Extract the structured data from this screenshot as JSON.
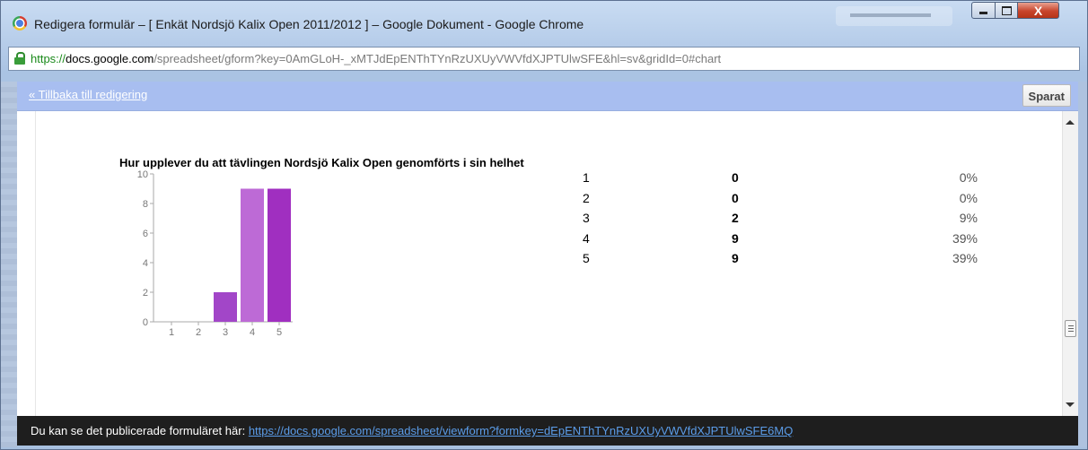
{
  "window": {
    "title": "Redigera formulär – [ Enkät Nordsjö Kalix Open 2011/2012 ] – Google Dokument - Google Chrome",
    "controls": {
      "minimize": "",
      "maximize": "",
      "close": "X"
    }
  },
  "address": {
    "scheme": "https://",
    "host": "docs.google.com",
    "path": "/spreadsheet/gform?key=0AmGLoH-_xMTJdEpENThTYnRzUXUyVWVfdXJPTUlwSFE&hl=sv&gridId=0#chart"
  },
  "dialog": {
    "back_link": "« Tillbaka till redigering",
    "saved_button": "Sparat"
  },
  "question": {
    "title": "Hur upplever du att tävlingen Nordsjö Kalix Open genomförts i sin helhet",
    "rows": [
      {
        "label": "1",
        "count": "0",
        "percent": "0%"
      },
      {
        "label": "2",
        "count": "0",
        "percent": "0%"
      },
      {
        "label": "3",
        "count": "2",
        "percent": "9%"
      },
      {
        "label": "4",
        "count": "9",
        "percent": "39%"
      },
      {
        "label": "5",
        "count": "9",
        "percent": "39%"
      }
    ]
  },
  "chart_data": {
    "type": "bar",
    "title": "Hur upplever du att tävlingen Nordsjö Kalix Open genomförts i sin helhet",
    "categories": [
      "1",
      "2",
      "3",
      "4",
      "5"
    ],
    "values": [
      0,
      0,
      2,
      9,
      9
    ],
    "ylim": [
      0,
      10
    ],
    "yticks": [
      0,
      2,
      4,
      6,
      8,
      10
    ],
    "xlabel": "",
    "ylabel": "",
    "colors": [
      "#b161cf",
      "#b161cf",
      "#a246c8",
      "#bd6ad6",
      "#a02fc0"
    ],
    "grid": false
  },
  "footer": {
    "text": "Du kan se det publicerade formuläret här: ",
    "link": "https://docs.google.com/spreadsheet/viewform?formkey=dEpENThTYnRzUXUyVWVfdXJPTUlwSFE6MQ"
  }
}
